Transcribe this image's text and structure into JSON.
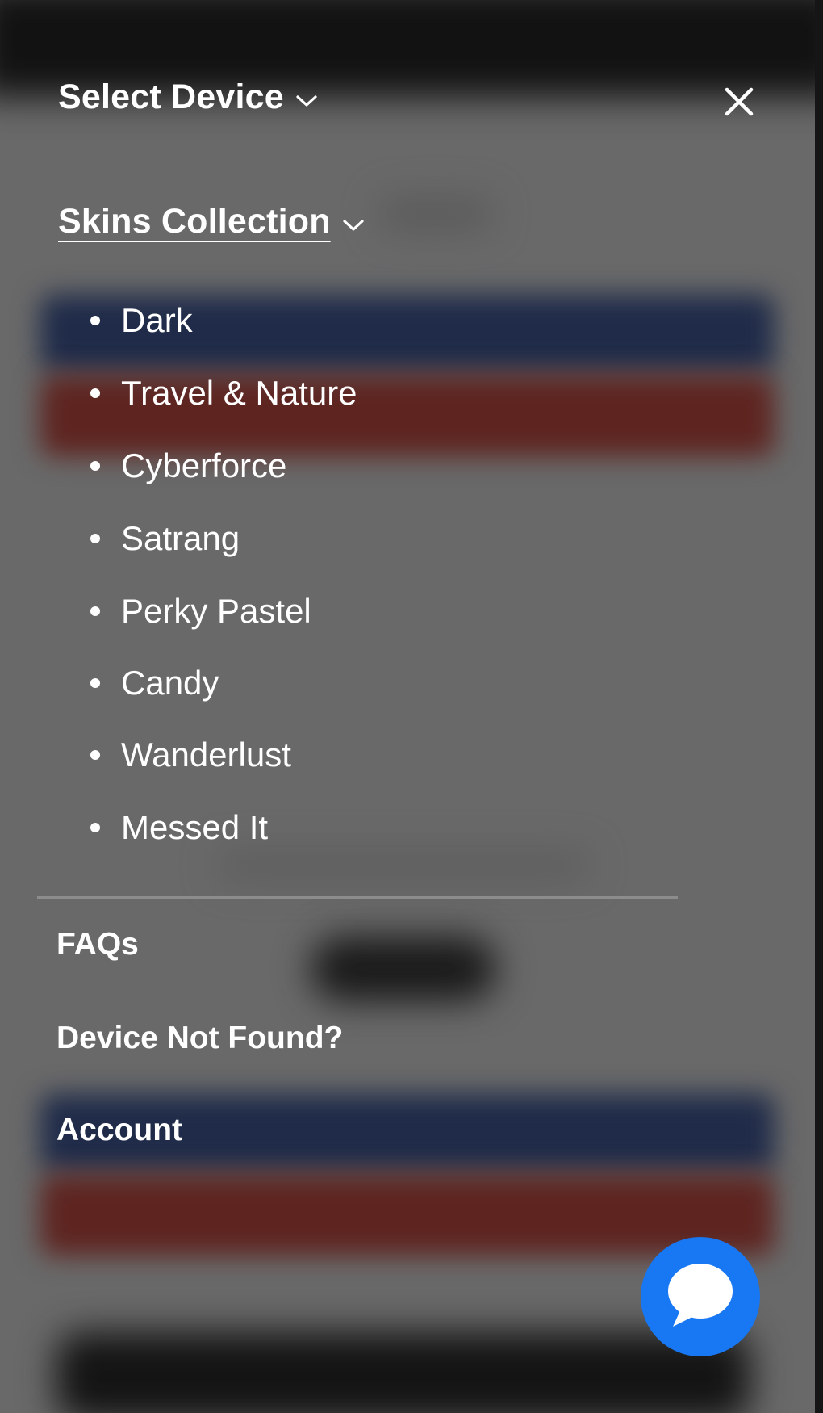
{
  "header": {
    "select_device_label": "Select Device",
    "icons": {
      "select_device_chevron": "chevron-down-icon",
      "close": "close-icon"
    }
  },
  "skins_collection": {
    "label": "Skins Collection",
    "chevron_icon": "chevron-down-icon",
    "items": [
      {
        "label": "Dark"
      },
      {
        "label": "Travel & Nature"
      },
      {
        "label": "Cyberforce"
      },
      {
        "label": "Satrang"
      },
      {
        "label": "Perky Pastel"
      },
      {
        "label": "Candy"
      },
      {
        "label": "Wanderlust"
      },
      {
        "label": "Messed It"
      }
    ]
  },
  "links": {
    "faqs": "FAQs",
    "device_not_found": "Device Not Found?",
    "account": "Account"
  },
  "chat": {
    "icon": "chat-bubble-icon"
  },
  "colors": {
    "overlay_background": "#696969",
    "menu_text": "#ffffff",
    "chat_button": "#1877f2",
    "backdrop_blue_band": "#1f2b49",
    "backdrop_red_band": "#5e2420"
  }
}
